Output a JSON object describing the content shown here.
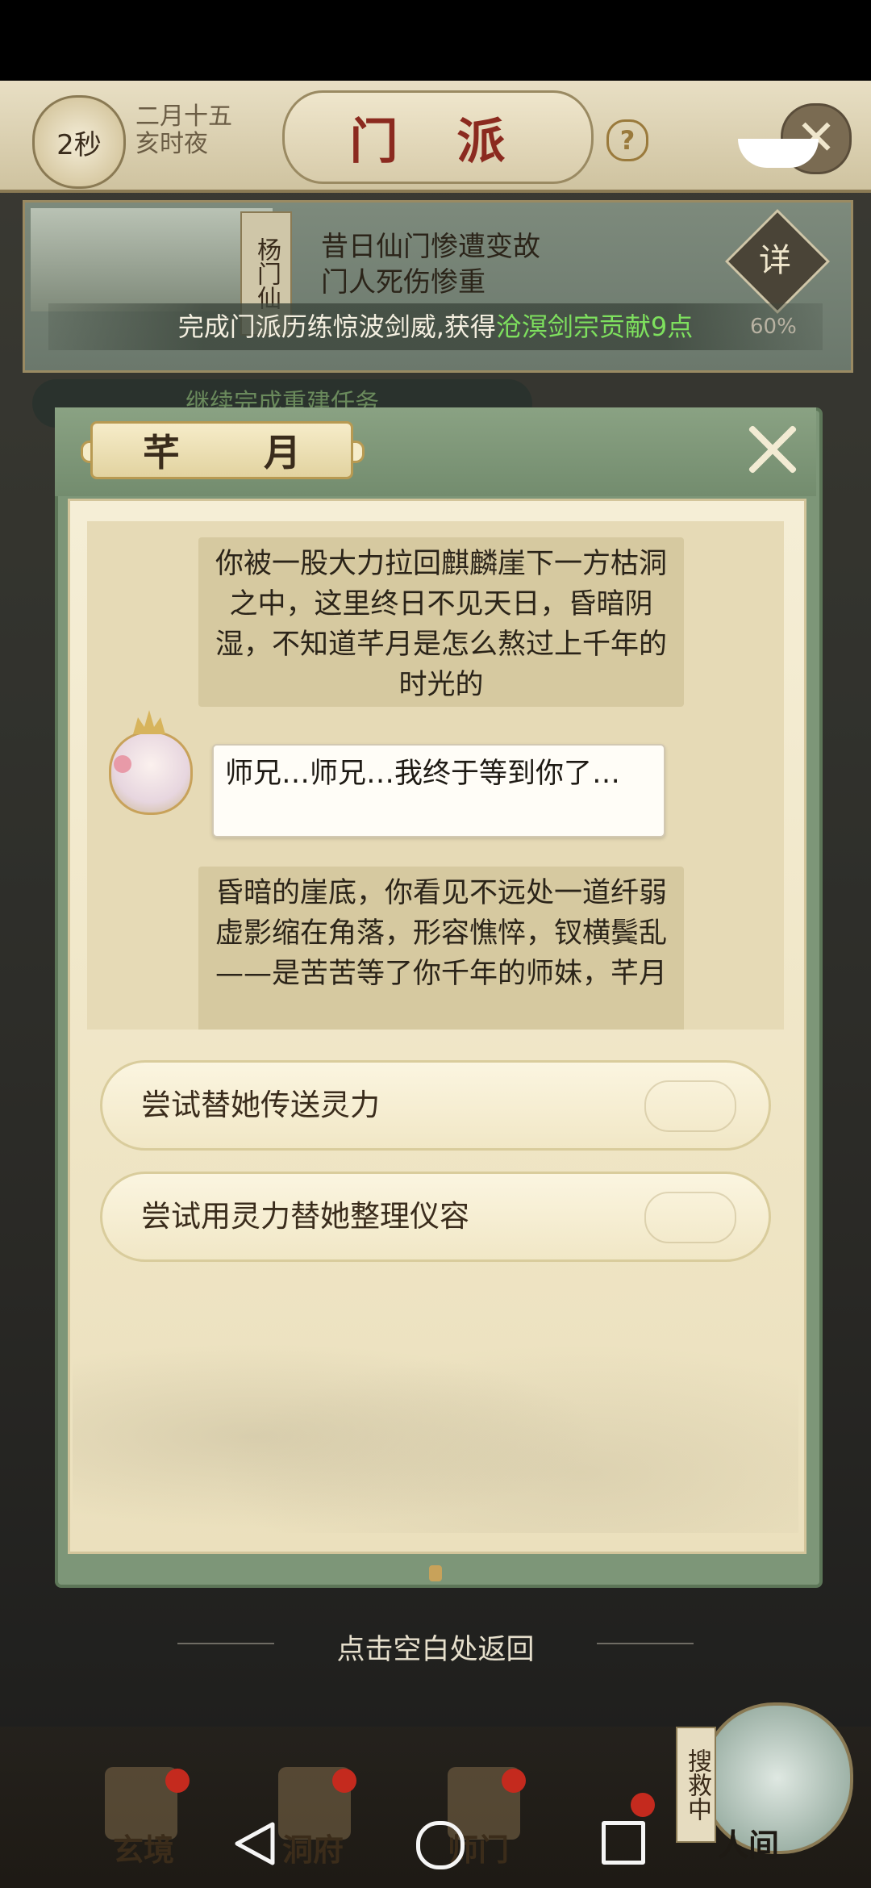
{
  "header": {
    "timer": "2秒",
    "date_line1": "二月十五",
    "date_line2": "亥时夜",
    "title": "门 派",
    "help_symbol": "?",
    "exit_symbol": "✕"
  },
  "event": {
    "banner": "杨门仙",
    "line1": "昔日仙门惨遭变故",
    "line2": "门人死伤惨重",
    "detail_button": "详",
    "reward_prefix": "完成门派历练惊波剑威,获得",
    "reward_highlight": "沧溟剑宗贡献9点",
    "progress": "60%"
  },
  "behind_task": "继续完成重建任务",
  "dialog": {
    "title": "芊 月",
    "close_symbol": "✕",
    "messages": [
      {
        "type": "narration",
        "text": "你被一股大力拉回麒麟崖下一方枯洞之中，这里终日不见天日，昏暗阴湿，不知道芊月是怎么熬过上千年的时光的"
      },
      {
        "type": "speech",
        "speaker": "芊月",
        "text": "师兄…师兄…我终于等到你了…"
      },
      {
        "type": "narration",
        "text": "昏暗的崖底，你看见不远处一道纤弱虚影缩在角落，形容憔悴，钗横鬓乱——是苦苦等了你千年的师妹，芊月"
      }
    ],
    "choices": [
      "尝试替她传送灵力",
      "尝试用灵力替她整理仪容"
    ]
  },
  "return_hint": "点击空白处返回",
  "bottom_nav": {
    "items": [
      "玄境",
      "洞府",
      "师门",
      "人间"
    ],
    "search_tag": "搜救中"
  },
  "colors": {
    "highlight": "#7ee05e",
    "title_red": "#8b2a1f",
    "dialog_green": "#7d9678",
    "parchment": "#f5eed6"
  }
}
